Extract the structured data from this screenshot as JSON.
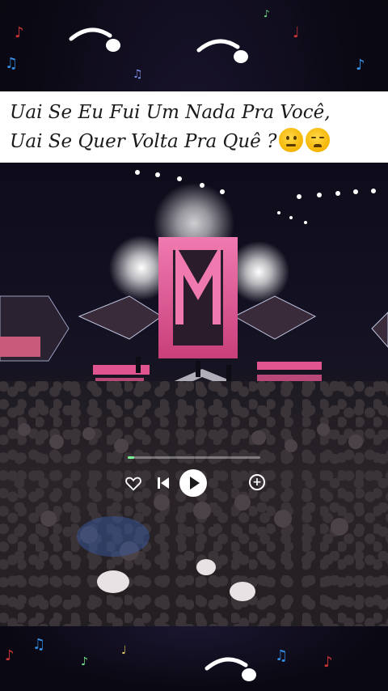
{
  "caption": {
    "line1": "Uai Se Eu Fui Um Nada Pra Você,",
    "line2": "Uai Se Quer Volta Pra Quê ?",
    "emojis": [
      "thinking-face-icon",
      "weary-face-icon"
    ]
  },
  "player": {
    "progress": 0.05,
    "icons": [
      "heart-icon",
      "skip-previous-icon",
      "play-icon",
      "add-icon"
    ]
  },
  "colors": {
    "background": "#0b0914",
    "caption_bg": "#ffffff",
    "stage_pink": "#e0558f",
    "progress_green": "#7dff9a"
  }
}
